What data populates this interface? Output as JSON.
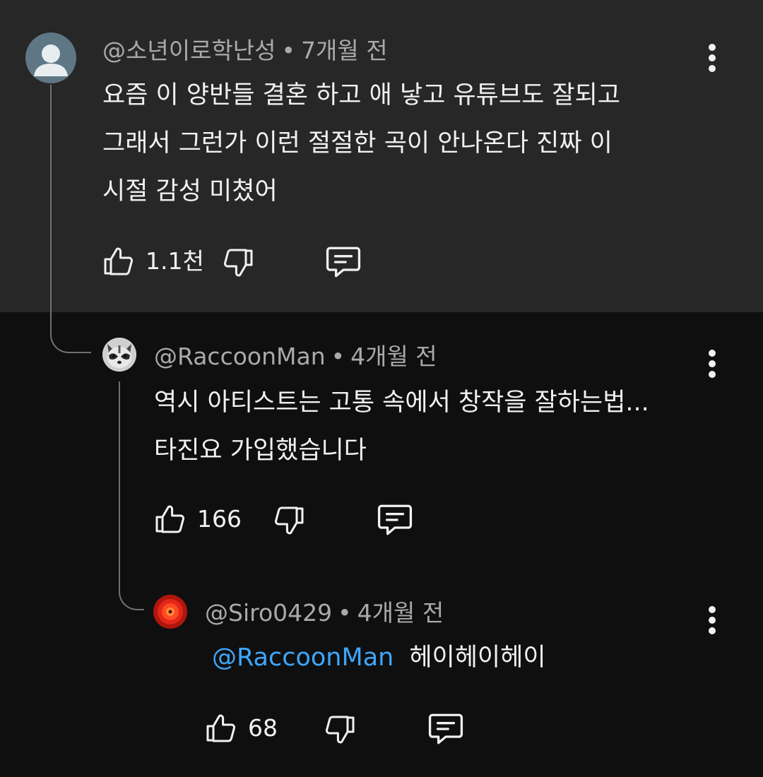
{
  "comments": [
    {
      "author": "@소년이로학난성",
      "time": "7개월 전",
      "lines": [
        "요즘 이 양반들 결혼 하고 애 낳고 유튜브도 잘되고",
        "그래서 그런가 이런 절절한 곡이 안나온다 진짜 이",
        "시절 감성 미쳤어"
      ],
      "likes": "1.1천"
    },
    {
      "author": "@RaccoonMan",
      "time": "4개월 전",
      "lines": [
        "역시 아티스트는 고통 속에서 창작을 잘하는법...",
        "타진요 가입했습니다"
      ],
      "likes": "166"
    },
    {
      "author": "@Siro0429",
      "time": "4개월 전",
      "mention": "@RaccoonMan",
      "text": "헤이헤이헤이",
      "likes": "68"
    }
  ],
  "separator": "•",
  "colors": {
    "top_background": "#272727",
    "page_background": "#0f0f0f",
    "mention": "#3ea6ff",
    "meta_text": "#aaaaaa"
  },
  "icons": [
    "default-avatar-icon",
    "thumbs-up-icon",
    "thumbs-down-icon",
    "reply-icon",
    "more-vert-icon"
  ]
}
